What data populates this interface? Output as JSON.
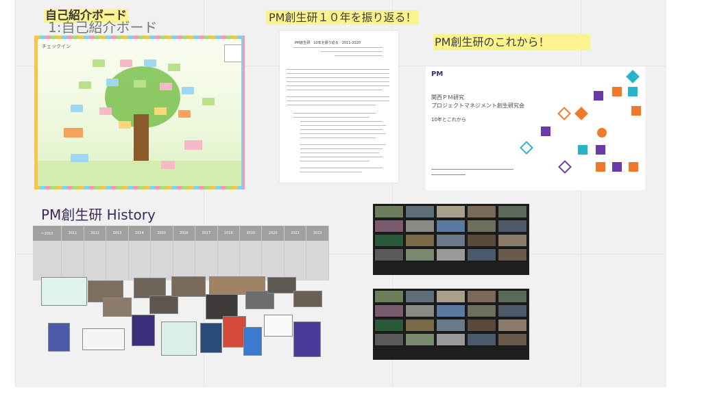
{
  "canvas": {
    "background": "#f1f1f1"
  },
  "labels": {
    "board_title": "自己紹介ボード",
    "board_subtitle": "1:自己紹介ボード",
    "lookback": "PM創生研１０年を振り返る！",
    "future": "PM創生研のこれから！",
    "history": "PM創生研 History"
  },
  "board": {
    "checkin": "チェックイン"
  },
  "doc": {
    "title": "PM創生研　10年を振り返る　2011-2020"
  },
  "slide": {
    "logo": "PM",
    "title_line1": "関西ＰＭ研究",
    "title_line2": "プロジェクトマネジメント創生研究会",
    "subtitle": "10年とこれから"
  },
  "history_table": {
    "years": [
      "～2010",
      "2011",
      "2012",
      "2013",
      "2014",
      "2015",
      "2016",
      "2017",
      "2018",
      "2019",
      "2020",
      "2021",
      "2022"
    ]
  },
  "colors": {
    "highlight": "#fbf38e",
    "history_title": "#3a2a5a"
  }
}
